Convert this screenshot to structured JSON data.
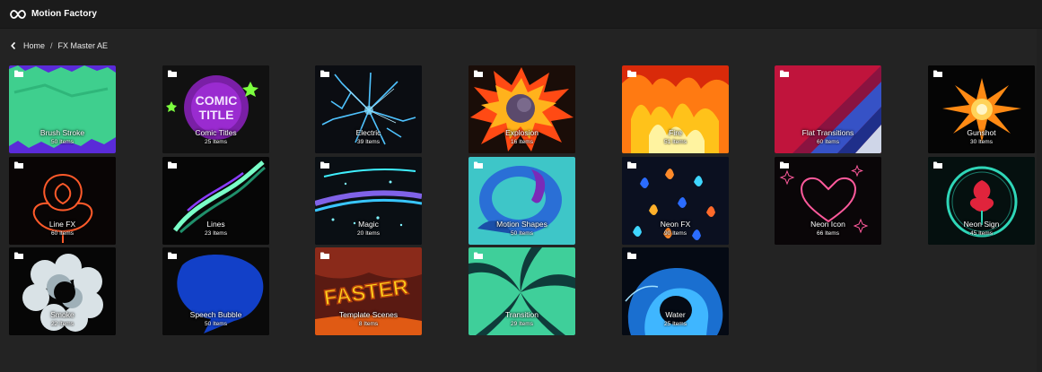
{
  "app": {
    "title": "Motion Factory",
    "logo_icon": "infinity-logo-icon"
  },
  "breadcrumb": {
    "back_icon": "chevron-left-icon",
    "home": "Home",
    "separator": "/",
    "current": "FX Master AE"
  },
  "folders": [
    {
      "name": "Brush Stroke",
      "count": "50 Items",
      "art": "brush"
    },
    {
      "name": "Comic Titles",
      "count": "25 Items",
      "art": "comic"
    },
    {
      "name": "Electric",
      "count": "39 Items",
      "art": "electric"
    },
    {
      "name": "Explosion",
      "count": "16 Items",
      "art": "explosion"
    },
    {
      "name": "Fire",
      "count": "51 Items",
      "art": "fire"
    },
    {
      "name": "Flat Transitions",
      "count": "60 Items",
      "art": "flat"
    },
    {
      "name": "Gunshot",
      "count": "30 Items",
      "art": "gunshot"
    },
    {
      "name": "Line FX",
      "count": "60 Items",
      "art": "linefx"
    },
    {
      "name": "Lines",
      "count": "23 Items",
      "art": "lines"
    },
    {
      "name": "Magic",
      "count": "20 Items",
      "art": "magic"
    },
    {
      "name": "Motion Shapes",
      "count": "50 Items",
      "art": "shapes"
    },
    {
      "name": "Neon FX",
      "count": "90 Items",
      "art": "neonfx"
    },
    {
      "name": "Neon Icon",
      "count": "66 Items",
      "art": "neonicon"
    },
    {
      "name": "Neon Sign",
      "count": "45 Items",
      "art": "neonsign"
    },
    {
      "name": "Smoke",
      "count": "22 Items",
      "art": "smoke"
    },
    {
      "name": "Speech Bubble",
      "count": "50 Items",
      "art": "bubble"
    },
    {
      "name": "Template Scenes",
      "count": "8 Items",
      "art": "template",
      "art_text": "FASTER"
    },
    {
      "name": "Transition",
      "count": "29 Items",
      "art": "transition"
    },
    {
      "name": "Water",
      "count": "25 Items",
      "art": "water"
    }
  ],
  "folder_icon": "folder-icon",
  "colors": {
    "topbar": "#1b1b1b",
    "background": "#232323",
    "text": "#ffffff"
  }
}
